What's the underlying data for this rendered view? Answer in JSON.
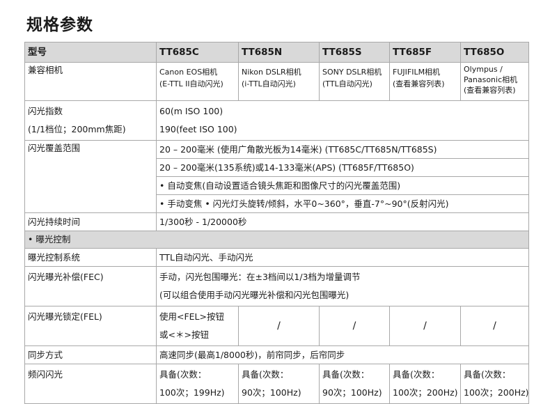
{
  "title": "规格参数",
  "header": {
    "label": "型号",
    "models": [
      "TT685C",
      "TT685N",
      "TT685S",
      "TT685F",
      "TT685O"
    ]
  },
  "compat": {
    "label": "兼容相机",
    "cells": [
      [
        "Canon EOS相机",
        "(E-TTL II自动闪光)"
      ],
      [
        "Nikon DSLR相机",
        "(i-TTL自动闪光)"
      ],
      [
        "SONY DSLR相机",
        "(TTL自动闪光)"
      ],
      [
        "FUJIFILM相机",
        "(查看兼容列表)"
      ],
      [
        "Olympus /",
        "Panasonic相机",
        "(查看兼容列表)"
      ]
    ]
  },
  "guide": {
    "label1": "闪光指数",
    "label2": "(1/1档位；200mm焦距)",
    "value1": "60(m ISO 100)",
    "value2": "190(feet ISO 100)"
  },
  "coverage": {
    "label": "闪光覆盖范围",
    "line1": "20 – 200毫米 (使用广角散光板为14毫米) (TT685C/TT685N/TT685S)",
    "line2": "20 – 200毫米(135系统)或14-133毫米(APS) (TT685F/TT685O)",
    "line3": "• 自动变焦(自动设置适合镜头焦距和图像尺寸的闪光覆盖范围)",
    "line4": "• 手动变焦    • 闪光灯头旋转/倾斜，水平0~360°，垂直-7°~90°(反射闪光)"
  },
  "duration": {
    "label": "闪光持续时间",
    "value": "1/300秒 - 1/20000秒"
  },
  "section_exposure": "• 曝光控制",
  "exposure_system": {
    "label": "曝光控制系统",
    "value": "TTL自动闪光、手动闪光"
  },
  "fec": {
    "label": "闪光曝光补偿(FEC)",
    "line1": "手动，闪光包围曝光：在±3档间以1/3档为增量调节",
    "line2": "(可以组合使用手动闪光曝光补偿和闪光包围曝光)"
  },
  "fel": {
    "label": "闪光曝光锁定(FEL)",
    "line1": "使用<FEL>按钮",
    "line2": "或<＊>按钮",
    "others": [
      "/",
      "/",
      "/",
      "/"
    ]
  },
  "sync": {
    "label": "同步方式",
    "value": "高速同步(最高1/8000秒)，前帘同步，后帘同步"
  },
  "stroboscopic": {
    "label": "频闪闪光",
    "cells": [
      [
        "具备(次数：",
        "100次；199Hz)"
      ],
      [
        "具备(次数：",
        "90次；100Hz)"
      ],
      [
        "具备(次数：",
        "90次；100Hz)"
      ],
      [
        "具备(次数：",
        "100次；200Hz)"
      ],
      [
        "具备(次数：",
        "100次；200Hz)"
      ]
    ]
  }
}
